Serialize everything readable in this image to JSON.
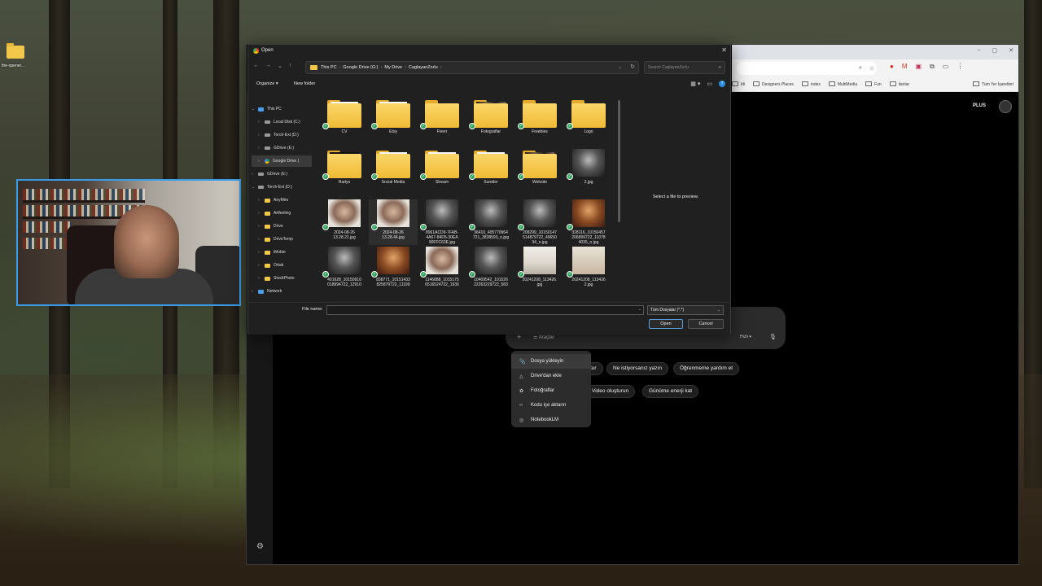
{
  "desktop": {
    "icon_label": "the-opener..."
  },
  "dialog": {
    "title": "Open",
    "breadcrumb": [
      "This PC",
      "Google Drive (G:)",
      "My Drive",
      "CaglayanZorlu"
    ],
    "search_placeholder": "Search CaglayanZorlu",
    "organize_label": "Organize ▾",
    "new_folder_label": "New folder",
    "tree": [
      {
        "label": "This PC",
        "icon": "pc",
        "level": 0,
        "expanded": true
      },
      {
        "label": "Local Disk (C:)",
        "icon": "disk",
        "level": 1
      },
      {
        "label": "Torch-Ext (D:)",
        "icon": "disk",
        "level": 1
      },
      {
        "label": "GDrive (E:)",
        "icon": "disk",
        "level": 1
      },
      {
        "label": "Google Drive (",
        "icon": "gdrive",
        "level": 1,
        "selected": true
      },
      {
        "label": "GDrive (E:)",
        "icon": "disk",
        "level": 0
      },
      {
        "label": "Torch-Ext (D:)",
        "icon": "disk",
        "level": 0,
        "expanded": true
      },
      {
        "label": "AnyMiro",
        "icon": "folder",
        "level": 1
      },
      {
        "label": "Artfeeling",
        "icon": "folder",
        "level": 1
      },
      {
        "label": "Drive",
        "icon": "folder",
        "level": 1
      },
      {
        "label": "DriveTemp",
        "icon": "folder",
        "level": 1
      },
      {
        "label": "iMobie",
        "icon": "folder",
        "level": 1
      },
      {
        "label": "Ortak",
        "icon": "folder",
        "level": 1
      },
      {
        "label": "StockPhoto",
        "icon": "folder",
        "level": 1
      },
      {
        "label": "Network",
        "icon": "net",
        "level": 0
      }
    ],
    "items": [
      {
        "label": "CV",
        "kind": "folder",
        "variant": "paper"
      },
      {
        "label": "Etsy",
        "kind": "folder",
        "variant": "paper"
      },
      {
        "label": "Fiverr",
        "kind": "folder",
        "variant": "plain"
      },
      {
        "label": "Fotograflar",
        "kind": "folder",
        "variant": "photo"
      },
      {
        "label": "Freebies",
        "kind": "folder",
        "variant": "plain"
      },
      {
        "label": "Logo",
        "kind": "folder",
        "variant": "plain"
      },
      {
        "label": "Radyo",
        "kind": "folder",
        "variant": "dark"
      },
      {
        "label": "Social Media",
        "kind": "folder",
        "variant": "paper"
      },
      {
        "label": "Stream",
        "kind": "folder",
        "variant": "paper"
      },
      {
        "label": "Suretler",
        "kind": "folder",
        "variant": "paper"
      },
      {
        "label": "Website",
        "kind": "folder",
        "variant": "photo"
      },
      {
        "label": "2.jpg",
        "kind": "photo",
        "variant": "bw"
      },
      {
        "label": "2024-08-26\n13.28.21.jpg",
        "kind": "photo",
        "variant": "face"
      },
      {
        "label": "2024-08-26\n13.28.44.jpg",
        "kind": "photo",
        "variant": "face",
        "hover": true
      },
      {
        "label": "8961ACD9-7FAB-\n4A67-84D5-30EA\n90FFC63E.jpg",
        "kind": "photo",
        "variant": "bw"
      },
      {
        "label": "36410_405770964\n721_3838593_n.jpg",
        "kind": "photo",
        "variant": "bw"
      },
      {
        "label": "208299_10150147\n514879722_49650\n34_n.jpg",
        "kind": "photo",
        "variant": "bw"
      },
      {
        "label": "328116_10150457\n206899722_11078\n4035_o.jpg",
        "kind": "photo",
        "variant": "warm"
      },
      {
        "label": "401628_10150910\n018994722_12910",
        "kind": "photo",
        "variant": "bw"
      },
      {
        "label": "838771_10151433\n825879722_11199",
        "kind": "photo",
        "variant": "warm"
      },
      {
        "label": "1146888_1015175\n6516524722_1936",
        "kind": "photo",
        "variant": "face"
      },
      {
        "label": "10409542_101526\n22263229722_583",
        "kind": "photo",
        "variant": "bw"
      },
      {
        "label": "20241208_113426.\njpg",
        "kind": "photo",
        "variant": "doc"
      },
      {
        "label": "20241208_113426\n2.jpg",
        "kind": "photo",
        "variant": "card"
      }
    ],
    "preview_text": "Select a file to preview.",
    "file_name_label": "File name:",
    "file_name_value": "",
    "file_type": "Tüm Dosyalar (*.*)",
    "open_label": "Open",
    "cancel_label": "Cancel"
  },
  "browser": {
    "bookmarks": [
      "ldi",
      "Designers Places",
      "index",
      "MultiMedia",
      "Fun",
      "ilanlar"
    ],
    "bookmarks_right": "Tüm Yer İşaretleri",
    "plus_badge": "PLUS",
    "compose": {
      "tools_label": "Araçlar",
      "speed_label": "Hızlı ▾"
    },
    "chips": [
      {
        "label": "tur",
        "partial": true
      },
      {
        "label": "Ne istiyorsanız yazın"
      },
      {
        "label": "Öğrenmeme yardım et"
      },
      {
        "label": "Video oluşturun"
      },
      {
        "label": "Günüme enerji kat"
      }
    ],
    "menu": [
      {
        "label": "Dosya yükleyin",
        "icon": "📎"
      },
      {
        "label": "Drive'dan ekle",
        "icon": "△"
      },
      {
        "label": "Fotoğraflar",
        "icon": "✿"
      },
      {
        "label": "Kodu içe aktarın",
        "icon": "‹›"
      },
      {
        "label": "NotebookLM",
        "icon": "◎"
      }
    ]
  }
}
